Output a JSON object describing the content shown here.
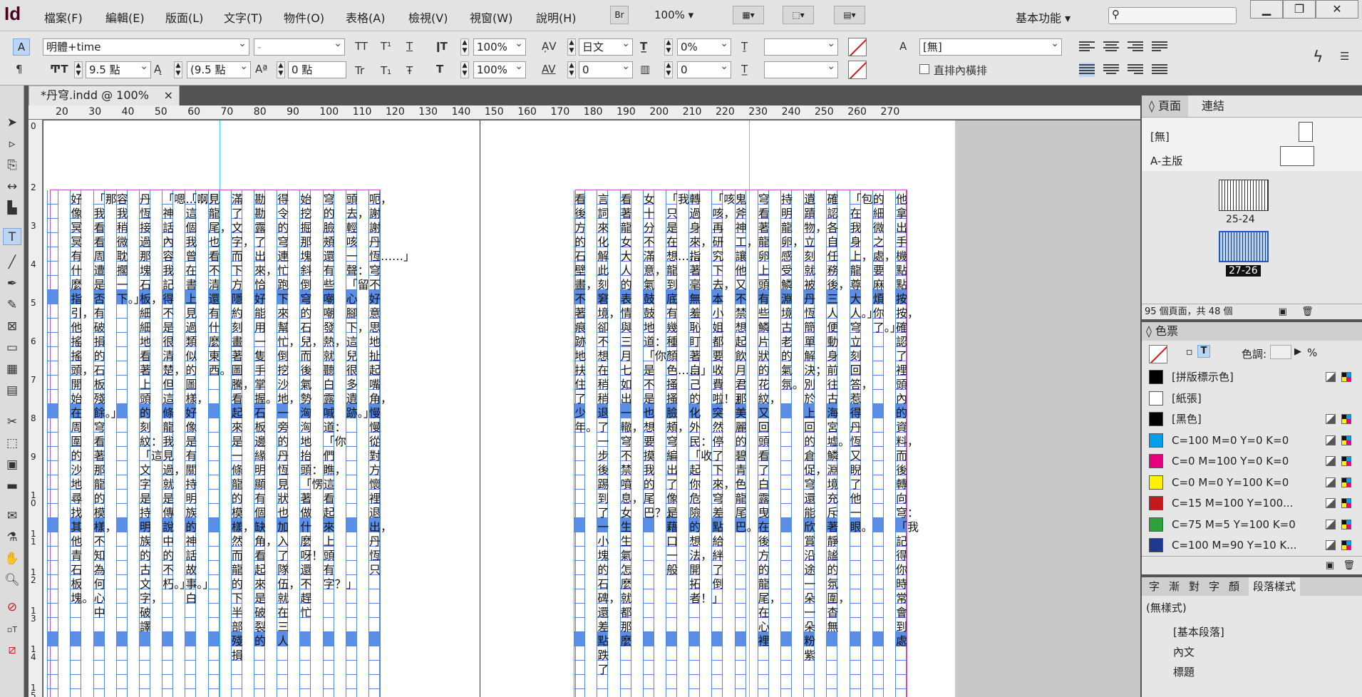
{
  "app": {
    "logo": "Id"
  },
  "menu": [
    "檔案(F)",
    "編輯(E)",
    "版面(L)",
    "文字(T)",
    "物件(O)",
    "表格(A)",
    "檢視(V)",
    "視窗(W)",
    "說明(H)"
  ],
  "menubar": {
    "br": "Br",
    "zoom": "100%",
    "workspace": "基本功能",
    "search_placeholder": ""
  },
  "control": {
    "font_family": "明體+time",
    "font_style": "-",
    "font_size": "9.5 點",
    "leading": "(9.5 點",
    "baseline": "0 點",
    "hscale": "100%",
    "vscale": "100%",
    "lang": "日文",
    "kerning": "0",
    "tsume": "0%",
    "grid_tsume": "0",
    "char_style": "[無]",
    "tate_chu_yoko": "直排內橫排",
    "tt_labels": [
      "TT",
      "T¹",
      "T",
      "Tr",
      "T₁",
      "Ŧ"
    ]
  },
  "document": {
    "tab_title": "*丹穹.indd @ 100%"
  },
  "ruler": {
    "h": [
      "20",
      "30",
      "40",
      "50",
      "60",
      "70",
      "80",
      "90",
      "100",
      "110",
      "120",
      "130",
      "140",
      "150",
      "160",
      "170",
      "180",
      "190",
      "200",
      "210",
      "220",
      "230",
      "240",
      "250",
      "260",
      "270"
    ],
    "v": [
      "0",
      "2",
      "3",
      "4",
      "5",
      "6",
      "7",
      "8",
      "9",
      "1 0",
      "1 1",
      "1 2",
      "1 3",
      "1 4",
      "1 5"
    ]
  },
  "left_page_columns": [
    "呃，謝謝丹恆……」穹不好意思地扯起嘴角，慢慢從對方懷裡退出，丹恆只",
    "頭去，輕咳一聲：「留心腳下，這兒很多遺跡。」",
    "穹的臉頰還有些嘲嘲發熱，就聽白露喊道：「你們瞧，這看起來上頭有字？」",
    "始挖掘那塊斜倒穹的石兒，而後氣勢洶洶地抬頭：「愣著做什麼呀！還不趕忙",
    "得令的穹連忙跑下來幫忙，倒挖沙地，一旁的丹恆見狀也加入了隊伍，就在三人",
    "勘勘露了出來，恰好能用一隻手掌握。石板邊緣明顯有個缺角，看起來是破裂的",
    "滿了文字，而下方隱約刻畫著圖騰，看起來是一條龍的模樣，然而龍的下半部殘損",
    "見龍尾，也看不清還有什麼東西。",
    "「啊！這個我曾在書上見過類似的圖樣，好像是有關持明族的神話故事。」白",
    "「嗯……神話內容我記得不是很清楚，但這條龍我見過，就是傳說中的不朽。」",
    "丹恆接過那塊石板，細細地看著上頭的刻紋：「這文字是持明族的古文字，破譯",
    "容我稍微耽擱一下。」",
    "「那我看看周遭是否有破損的石板殘餘。」穹看著那龍的模樣，不知為何心中",
    "好像冥冥有什麼指引，他搖搖頭，開始在周圍的沙地尋找其他青石板塊。"
  ],
  "right_page_columns": [
    "他拿出手機點點按按，確認了裡頭內的資料，而後轉向穹：「我記得你時常會到處",
    "的細微之處，要麻煩你了。」",
    "「包在我身上，龍尊大人。」穹立刻回答，惹得丹恆又睨了他一眼。",
    "確認各自任務後，三人便動身前往古海宮墟。鱗淵境充斥著靜謐的氛圍，杳無",
    "遺蹟物，立刻就被丹恆簡單解決；別於上回的倉促，穹還能欣賞沿途一朵一朵粉紫",
    "持明龍卵，感受鱗淵境古老的氣氛。",
    "穹看著龍卵上頭有些鱗片狀的花紋，又回頭看了白露曳在後方的龍尾，在心裡",
    "鬼斧神工，讓他又不禁想起飲月君那美麗的碧青色龍尾巴。",
    "「咳咳，再研究下去，本小姐都要收費啦！」突然停了下來，穹差點給絆了倒",
    "轉過身來，指著毫無羞恥盯著自己的化外民：「收起你危險的想法，開拓者！」",
    "「我只是在想……龍到底有幾種顏色……」搔搔臉頰，穹編出了像是藉口一般",
    "女十分不滿意，氣鼓鼓地道：「你是不是也想要摸我的尾巴？」",
    "看著龍女大人的表情與三月七如出一轍，穹不禁噴息，女生生氣怎麼就都那麼",
    "言詞來化解此刻窘境，卻不想在稍稍退了一步後踢到了一小塊的石碑，還差點跌了",
    "看後方的石壁畫，不著痕跡地扶住了少年。"
  ],
  "pages_panel": {
    "tabs": [
      "頁面",
      "連結"
    ],
    "none_label": "[無]",
    "master_label": "A-主版",
    "spreads": [
      "25-24",
      "27-26"
    ],
    "status": "95 個頁面，共 48 個"
  },
  "swatches_panel": {
    "title": "色票",
    "tint_label": "色調:",
    "tint_value": "",
    "percent": "%",
    "items": [
      {
        "name": "[拼版標示色]",
        "color": "#000000"
      },
      {
        "name": "[紙張]",
        "color": "#ffffff"
      },
      {
        "name": "[黑色]",
        "color": "#000000"
      },
      {
        "name": "C=100 M=0 Y=0 K=0",
        "color": "#00a0e9"
      },
      {
        "name": "C=0 M=100 Y=0 K=0",
        "color": "#e4007f"
      },
      {
        "name": "C=0 M=0 Y=100 K=0",
        "color": "#fff100"
      },
      {
        "name": "C=15 M=100 Y=100...",
        "color": "#c8161d"
      },
      {
        "name": "C=75 M=5 Y=100 K=0",
        "color": "#2aa13b"
      },
      {
        "name": "C=100 M=90 Y=10 K...",
        "color": "#1d3a8f"
      }
    ]
  },
  "para_panel": {
    "tabs": [
      "字",
      "漸",
      "對",
      "字",
      "顏"
    ],
    "title": "段落樣式",
    "current": "(無樣式)",
    "items": [
      "[基本段落]",
      "內文",
      "標題"
    ]
  }
}
